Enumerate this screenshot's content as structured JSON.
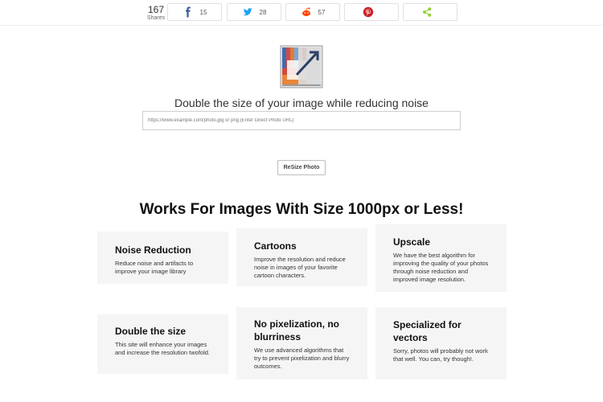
{
  "share": {
    "count": "167",
    "count_label": "Shares",
    "buttons": [
      {
        "network": "facebook",
        "icon": "facebook-icon",
        "count": "15",
        "color": "#3b5998"
      },
      {
        "network": "twitter",
        "icon": "twitter-icon",
        "count": "28",
        "color": "#1da1f2"
      },
      {
        "network": "reddit",
        "icon": "reddit-icon",
        "count": "57",
        "color": "#ff4500"
      },
      {
        "network": "pinterest",
        "icon": "pinterest-icon",
        "count": "",
        "color": "#cb2027"
      },
      {
        "network": "sharethis",
        "icon": "share-icon",
        "count": "",
        "color": "#95d03a"
      }
    ]
  },
  "hero": {
    "headline": "Double the size of your image while reducing noise",
    "url_placeholder": "https://www.example.com/photo.jpg or png (Enter Direct Photo URL)",
    "url_value": "",
    "resize_label": "ReSize Photo"
  },
  "features": {
    "title": "Works For Images With Size 1000px or Less!",
    "cards": [
      {
        "title": "Noise Reduction",
        "text": "Reduce noise and artifacts to improve your image library"
      },
      {
        "title": "Cartoons",
        "text": "Improve the resolution and reduce noise in images of your favorite cartoon characters."
      },
      {
        "title": "Upscale",
        "text": "We have the best algorithm for improving the quality of your photos through noise reduction and improved image resolution."
      },
      {
        "title": "Double the size",
        "text": "This site will enhance your images and increase the resolution twofold."
      },
      {
        "title": "No pixelization, no blurriness",
        "text": "We use advanced algorithms that try to prevent pixelization and blurry outcomes."
      },
      {
        "title": "Specialized for vectors",
        "text": "Sorry, photos will probably not work that well. You can, try though!."
      }
    ]
  }
}
